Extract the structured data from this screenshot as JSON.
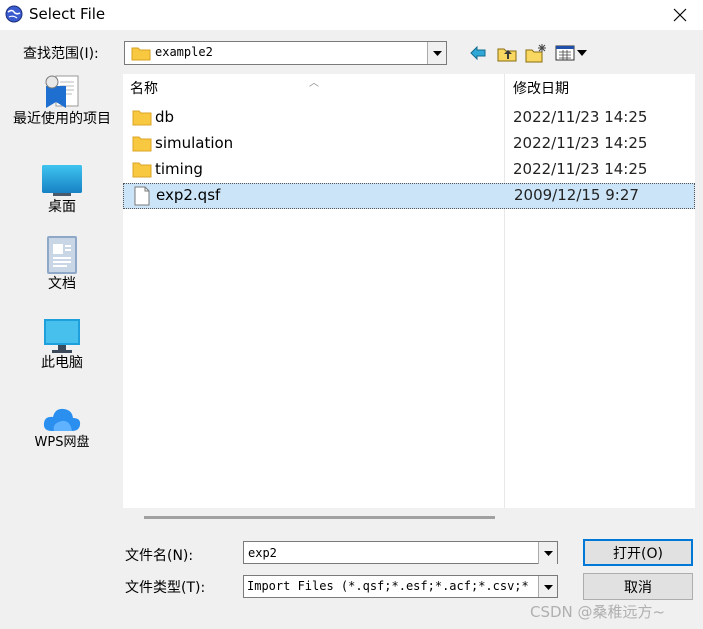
{
  "window": {
    "title": "Select File"
  },
  "toolbar": {
    "lookin_label": "查找范围(I):",
    "current_folder": "example2"
  },
  "places": [
    {
      "label": "最近使用的项目",
      "icon": "recent-items-icon"
    },
    {
      "label": "桌面",
      "icon": "desktop-icon"
    },
    {
      "label": "文档",
      "icon": "documents-icon"
    },
    {
      "label": "此电脑",
      "icon": "computer-icon"
    },
    {
      "label": "WPS网盘",
      "icon": "cloud-drive-icon"
    }
  ],
  "filelist": {
    "columns": {
      "name": "名称",
      "modified": "修改日期"
    },
    "rows": [
      {
        "name": "db",
        "modified": "2022/11/23 14:25",
        "type": "folder"
      },
      {
        "name": "simulation",
        "modified": "2022/11/23 14:25",
        "type": "folder"
      },
      {
        "name": "timing",
        "modified": "2022/11/23 14:25",
        "type": "folder"
      },
      {
        "name": "exp2.qsf",
        "modified": "2009/12/15 9:27",
        "type": "file",
        "selected": true
      }
    ]
  },
  "footer": {
    "filename_label": "文件名(N):",
    "filename_value": "exp2",
    "filetype_label": "文件类型(T):",
    "filetype_value": "Import Files (*.qsf;*.esf;*.acf;*.csv;*",
    "open_label": "打开(O)",
    "cancel_label": "取消"
  },
  "watermark": "CSDN @桑稚远方~",
  "colors": {
    "selection": "#cce4f7",
    "default_button_border": "#0078d7"
  }
}
